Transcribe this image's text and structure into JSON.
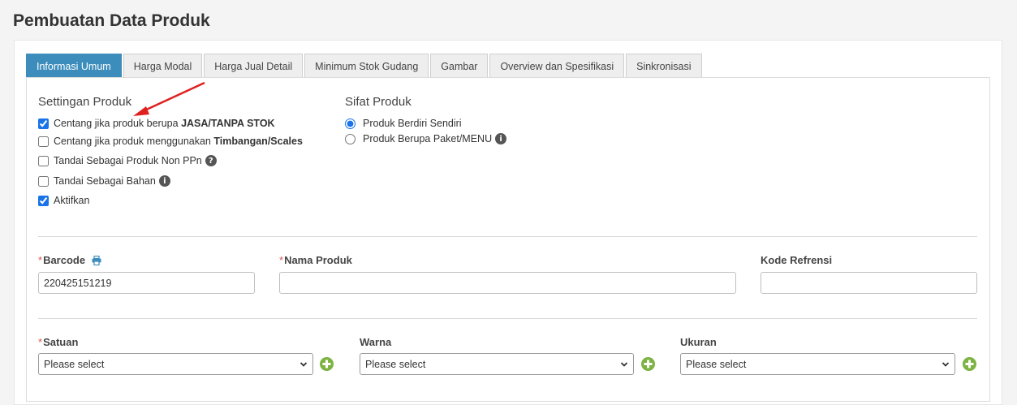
{
  "page": {
    "title": "Pembuatan Data Produk"
  },
  "tabs": [
    {
      "label": "Informasi Umum",
      "active": true
    },
    {
      "label": "Harga Modal"
    },
    {
      "label": "Harga Jual Detail"
    },
    {
      "label": "Minimum Stok Gudang"
    },
    {
      "label": "Gambar"
    },
    {
      "label": "Overview dan Spesifikasi"
    },
    {
      "label": "Sinkronisasi"
    }
  ],
  "settings": {
    "title": "Settingan Produk",
    "jasa": {
      "prefix": "Centang jika produk berupa ",
      "bold": "JASA/TANPA STOK",
      "checked": true
    },
    "timbangan": {
      "prefix": "Centang jika produk menggunakan ",
      "bold": "Timbangan/Scales",
      "checked": false
    },
    "non_ppn": {
      "label": "Tandai Sebagai Produk Non PPn",
      "icon": "question-circle-icon",
      "checked": false
    },
    "bahan": {
      "label": "Tandai Sebagai Bahan",
      "icon": "info-circle-icon",
      "checked": false
    },
    "aktifkan": {
      "label": "Aktifkan",
      "checked": true
    }
  },
  "sifat": {
    "title": "Sifat Produk",
    "berdiri_sendiri": {
      "label": "Produk Berdiri Sendiri",
      "selected": true
    },
    "paket": {
      "label": "Produk Berupa Paket/MENU",
      "icon": "info-circle-icon",
      "selected": false
    }
  },
  "fields": {
    "required_mark": "*",
    "barcode": {
      "label": "Barcode",
      "value": "220425151219",
      "icon": "printer-icon"
    },
    "nama_produk": {
      "label": "Nama Produk",
      "value": ""
    },
    "kode_refrensi": {
      "label": "Kode Refrensi",
      "value": ""
    },
    "satuan": {
      "label": "Satuan",
      "selected": "Please select"
    },
    "warna": {
      "label": "Warna",
      "selected": "Please select"
    },
    "ukuran": {
      "label": "Ukuran",
      "selected": "Please select"
    }
  },
  "colors": {
    "accent": "#3c8dbc",
    "required": "#d9534f",
    "add_button": "#7cb342",
    "annotation_arrow": "#e0201f"
  }
}
